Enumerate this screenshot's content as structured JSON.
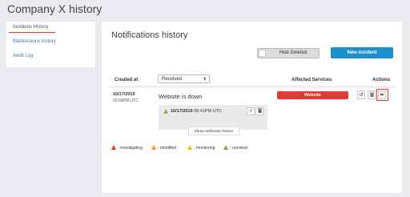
{
  "page": {
    "title": "Company X history"
  },
  "sidebar": {
    "items": [
      {
        "label": "Incidents History"
      },
      {
        "label": "Maintenance history"
      },
      {
        "label": "Audit Log"
      }
    ]
  },
  "main": {
    "title": "Notifications history",
    "hide_deleted_label": "Hide Deleted",
    "new_incident_label": "New incident",
    "columns": {
      "created_at": "Created at",
      "affected_services": "Affected Services",
      "actions": "Actions"
    },
    "filter": {
      "selected": "Resolved"
    },
    "incident": {
      "date": "10/17/2019",
      "time": "02:09PM UTC",
      "title": "Website is down",
      "update_date": "10/17/2019",
      "update_time": "05:41PM UTC",
      "show_history_label": "Show notification history",
      "service": "Website"
    }
  },
  "legend": [
    {
      "label": "- investigating",
      "color": "#e53935"
    },
    {
      "label": "- identified",
      "color": "#f39c12"
    },
    {
      "label": "- monitoring",
      "color": "#f1c40f"
    },
    {
      "label": "- resolved",
      "color": "#7cb342"
    }
  ],
  "colors": {
    "accent": "#1a8fc9",
    "danger": "#e53935",
    "link": "#3a7ab8"
  },
  "icons": {
    "undo": "undo-icon",
    "delete": "trash-icon",
    "share": "share-icon",
    "chevron": "chevron-updown-icon"
  }
}
